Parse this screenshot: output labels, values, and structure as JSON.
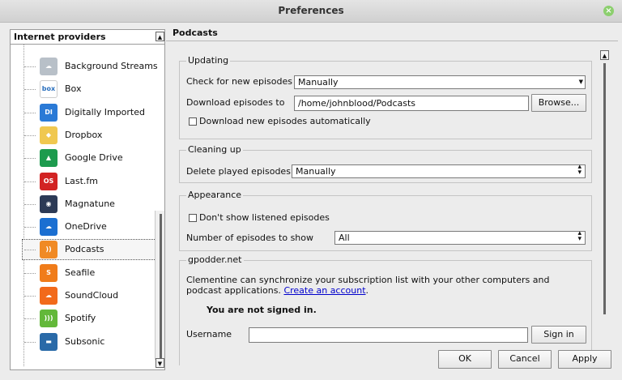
{
  "window": {
    "title": "Preferences",
    "close_label": "×"
  },
  "sidebar": {
    "header": "Internet providers",
    "items": [
      {
        "label": "Background Streams",
        "icon": "cloud-icon",
        "glyph": "☁",
        "color": "#b8c0c8"
      },
      {
        "label": "Box",
        "icon": "box-icon",
        "glyph": "box",
        "color": "#ffffff"
      },
      {
        "label": "Digitally Imported",
        "icon": "digitally-imported-icon",
        "glyph": "DI",
        "color": "#2a7ad6"
      },
      {
        "label": "Dropbox",
        "icon": "dropbox-icon",
        "glyph": "◆",
        "color": "#f0c850"
      },
      {
        "label": "Google Drive",
        "icon": "google-drive-icon",
        "glyph": "▲",
        "color": "#1d9b4e"
      },
      {
        "label": "Last.fm",
        "icon": "lastfm-icon",
        "glyph": "OS",
        "color": "#d22323"
      },
      {
        "label": "Magnatune",
        "icon": "magnatune-icon",
        "glyph": "◉",
        "color": "#2c3a56"
      },
      {
        "label": "OneDrive",
        "icon": "onedrive-icon",
        "glyph": "☁",
        "color": "#1b6fd1"
      },
      {
        "label": "Podcasts",
        "icon": "rss-icon",
        "glyph": "))",
        "color": "#f08a24"
      },
      {
        "label": "Seafile",
        "icon": "seafile-icon",
        "glyph": "S",
        "color": "#f07c1a"
      },
      {
        "label": "SoundCloud",
        "icon": "soundcloud-icon",
        "glyph": "☁",
        "color": "#f26a1b"
      },
      {
        "label": "Spotify",
        "icon": "spotify-icon",
        "glyph": ")))",
        "color": "#63b83a"
      },
      {
        "label": "Subsonic",
        "icon": "subsonic-icon",
        "glyph": "▬",
        "color": "#2a6aa8"
      }
    ],
    "selected_index": 8
  },
  "page": {
    "title": "Podcasts",
    "updating": {
      "title": "Updating",
      "check_label": "Check for new episodes",
      "check_value": "Manually",
      "download_label": "Download episodes to",
      "download_value": "/home/johnblood/Podcasts",
      "browse_label": "Browse...",
      "auto_download_label": "Download new episodes automatically",
      "auto_download_checked": false
    },
    "cleaning": {
      "title": "Cleaning up",
      "delete_label": "Delete played episodes",
      "delete_value": "Manually"
    },
    "appearance": {
      "title": "Appearance",
      "dont_show_label": "Don't show listened episodes",
      "dont_show_checked": false,
      "number_label": "Number of episodes to show",
      "number_value": "All"
    },
    "gpodder": {
      "title": "gpodder.net",
      "description": "Clementine can synchronize your subscription list with your other computers and podcast applications.",
      "link": "Create an account",
      "link_suffix": ".",
      "status": "You are not signed in.",
      "username_label": "Username",
      "username_value": "",
      "signin_label": "Sign in"
    }
  },
  "footer": {
    "ok": "OK",
    "cancel": "Cancel",
    "apply": "Apply"
  }
}
